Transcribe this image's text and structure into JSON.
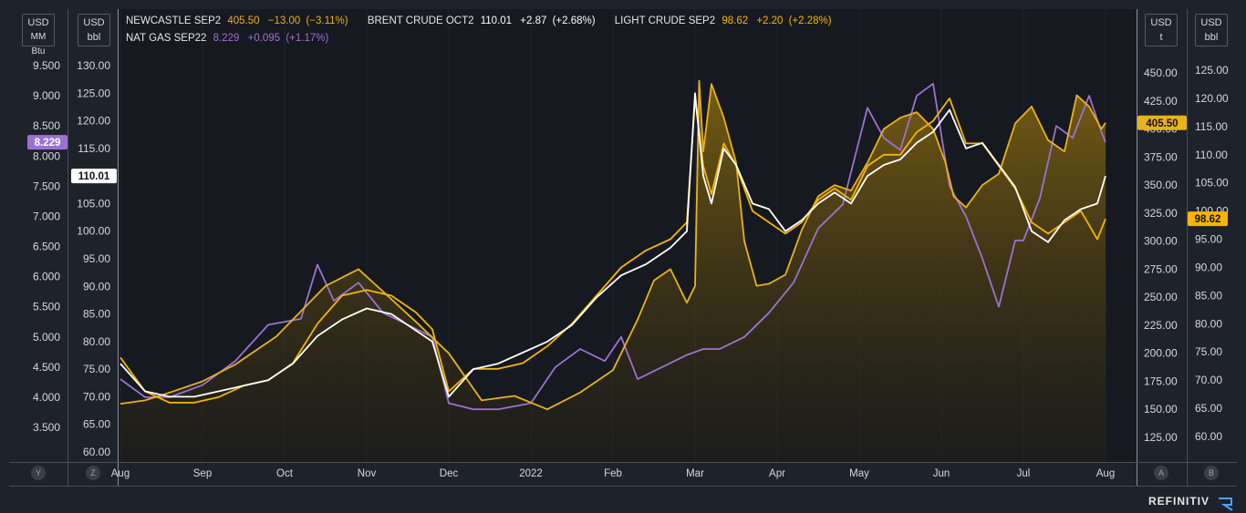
{
  "header": {
    "row1": [
      {
        "name": "NEWCASTLE SEP2",
        "value": "405.50",
        "change": "−13.00",
        "pct": "(−3.11%)",
        "color": "#e8b21e"
      },
      {
        "name": "BRENT CRUDE OCT2",
        "value": "110.01",
        "change": "+2.87",
        "pct": "(+2.68%)",
        "color": "#ffffff"
      },
      {
        "name": "LIGHT CRUDE SEP2",
        "value": "98.62",
        "change": "+2.20",
        "pct": "(+2.28%)",
        "color": "#f7b500"
      }
    ],
    "row2": [
      {
        "name": "NAT GAS SEP22",
        "value": "8.229",
        "change": "+0.095",
        "pct": "(+1.17%)",
        "color": "#9b72d0"
      }
    ]
  },
  "units": {
    "left1": {
      "cur": "USD",
      "unit": "MM Btu"
    },
    "left2": {
      "cur": "USD",
      "unit": "bbl"
    },
    "right1": {
      "cur": "USD",
      "unit": "t"
    },
    "right2": {
      "cur": "USD",
      "unit": "bbl"
    }
  },
  "axis_buttons": {
    "y": "Y",
    "z": "Z",
    "a": "A",
    "b": "B"
  },
  "brand": "REFINITIV",
  "colors": {
    "background": "#1e222b",
    "plot": "#161920",
    "coal": "#e8b21e",
    "brent": "#ffffff",
    "wti": "#f7b500",
    "gas": "#9b72d0"
  },
  "chart_data": {
    "type": "line",
    "x_labels": [
      "Aug",
      "Sep",
      "Oct",
      "Nov",
      "Dec",
      "2022",
      "Feb",
      "Mar",
      "Apr",
      "May",
      "Jun",
      "Jul",
      "Aug"
    ],
    "axes": {
      "gas": {
        "ticks": [
          "9.500",
          "9.000",
          "8.500",
          "8.000",
          "7.500",
          "7.000",
          "6.500",
          "6.000",
          "5.500",
          "5.000",
          "4.500",
          "4.000",
          "3.500"
        ],
        "range": [
          3.5,
          9.5
        ]
      },
      "oil_left": {
        "ticks": [
          "130.00",
          "125.00",
          "120.00",
          "115.00",
          "110.00",
          "105.00",
          "100.00",
          "95.00",
          "90.00",
          "85.00",
          "80.00",
          "75.00",
          "70.00",
          "65.00",
          "60.00"
        ],
        "range": [
          60,
          130
        ]
      },
      "coal": {
        "ticks": [
          "450.00",
          "425.00",
          "400.00",
          "375.00",
          "350.00",
          "325.00",
          "300.00",
          "275.00",
          "250.00",
          "225.00",
          "200.00",
          "175.00",
          "150.00",
          "125.00"
        ],
        "range": [
          125,
          450
        ]
      },
      "oil_right": {
        "ticks": [
          "125.00",
          "120.00",
          "115.00",
          "110.00",
          "105.00",
          "100.00",
          "95.00",
          "90.00",
          "85.00",
          "80.00",
          "75.00",
          "70.00",
          "65.00",
          "60.00"
        ],
        "range": [
          60,
          125
        ]
      }
    },
    "last_value_labels": {
      "gas": "8.229",
      "brent": "110.01",
      "coal": "405.50",
      "wti": "98.62"
    },
    "series": [
      {
        "name": "NEWCASTLE SEP2",
        "axis": "coal",
        "area": true,
        "x": [
          0,
          0.3,
          0.6,
          1,
          1.4,
          1.9,
          2.5,
          2.9,
          3.2,
          3.6,
          4,
          4.4,
          4.8,
          5.2,
          5.6,
          6,
          6.3,
          6.5,
          6.7,
          6.9,
          7,
          7.05,
          7.1,
          7.2,
          7.35,
          7.5,
          7.6,
          7.75,
          7.9,
          8.1,
          8.3,
          8.5,
          8.7,
          8.9,
          9.1,
          9.3,
          9.5,
          9.7,
          9.9,
          10.05,
          10.15,
          10.3,
          10.5,
          10.7,
          10.9,
          11.1,
          11.3,
          11.5,
          11.65,
          11.8,
          11.95,
          12
        ],
        "y": [
          155,
          158,
          165,
          175,
          190,
          215,
          260,
          275,
          255,
          228,
          200,
          158,
          162,
          150,
          165,
          185,
          230,
          265,
          275,
          245,
          260,
          443,
          380,
          440,
          410,
          370,
          300,
          260,
          262,
          270,
          310,
          340,
          350,
          345,
          370,
          400,
          410,
          415,
          400,
          370,
          340,
          330,
          350,
          360,
          405,
          420,
          390,
          380,
          430,
          420,
          400,
          405.5
        ]
      },
      {
        "name": "BRENT CRUDE OCT2",
        "axis": "oil_left",
        "x": [
          0,
          0.3,
          0.6,
          0.9,
          1.2,
          1.5,
          1.8,
          2.1,
          2.4,
          2.7,
          3,
          3.3,
          3.6,
          3.8,
          4,
          4.3,
          4.6,
          4.9,
          5.2,
          5.5,
          5.8,
          6.1,
          6.4,
          6.7,
          6.9,
          7,
          7.1,
          7.2,
          7.35,
          7.5,
          7.7,
          7.9,
          8.1,
          8.3,
          8.5,
          8.7,
          8.9,
          9.1,
          9.3,
          9.5,
          9.7,
          9.9,
          10.1,
          10.3,
          10.5,
          10.7,
          10.9,
          11.1,
          11.3,
          11.5,
          11.7,
          11.9,
          12
        ],
        "y": [
          76,
          71,
          70,
          70,
          71,
          72,
          73,
          76,
          81,
          84,
          86,
          85,
          82,
          80,
          70,
          75,
          76,
          78,
          80,
          83,
          88,
          92,
          94,
          97,
          100,
          125,
          110,
          105,
          115,
          112,
          105,
          104,
          100,
          102,
          105,
          107,
          105,
          110,
          112,
          113,
          116,
          118,
          122,
          115,
          116,
          112,
          108,
          100,
          98,
          102,
          104,
          105,
          110.01
        ]
      },
      {
        "name": "LIGHT CRUDE SEP2",
        "axis": "oil_right",
        "x": [
          0,
          0.3,
          0.6,
          0.9,
          1.2,
          1.5,
          1.8,
          2.1,
          2.4,
          2.7,
          3,
          3.3,
          3.6,
          3.8,
          4,
          4.3,
          4.6,
          4.9,
          5.2,
          5.5,
          5.8,
          6.1,
          6.4,
          6.7,
          6.9,
          7,
          7.1,
          7.2,
          7.35,
          7.5,
          7.7,
          7.9,
          8.1,
          8.3,
          8.5,
          8.7,
          8.9,
          9.1,
          9.3,
          9.5,
          9.7,
          9.9,
          10.1,
          10.3,
          10.5,
          10.7,
          10.9,
          11.1,
          11.3,
          11.5,
          11.7,
          11.9,
          12
        ],
        "y": [
          74,
          68,
          66,
          66,
          67,
          69,
          70,
          73,
          80,
          85,
          86,
          85,
          82,
          79,
          68,
          72,
          72,
          73,
          76,
          80,
          85,
          90,
          93,
          95,
          98,
          120,
          108,
          103,
          112,
          108,
          100,
          98,
          96,
          98,
          102,
          104,
          102,
          108,
          110,
          110,
          114,
          116,
          120,
          112,
          112,
          108,
          104,
          98,
          96,
          98,
          100,
          95,
          98.62
        ]
      },
      {
        "name": "NAT GAS SEP22",
        "axis": "gas",
        "x": [
          0,
          0.3,
          0.6,
          1,
          1.4,
          1.8,
          2.2,
          2.4,
          2.6,
          2.9,
          3.2,
          3.5,
          3.8,
          4,
          4.3,
          4.6,
          5,
          5.3,
          5.6,
          5.9,
          6.1,
          6.3,
          6.6,
          6.9,
          7.1,
          7.3,
          7.6,
          7.9,
          8.2,
          8.5,
          8.8,
          9.1,
          9.3,
          9.5,
          9.7,
          9.9,
          10.1,
          10.3,
          10.5,
          10.7,
          10.9,
          11,
          11.2,
          11.4,
          11.6,
          11.8,
          11.95,
          12
        ],
        "y": [
          4.3,
          4.0,
          4.0,
          4.2,
          4.6,
          5.2,
          5.3,
          6.2,
          5.6,
          5.9,
          5.4,
          5.2,
          5.0,
          3.9,
          3.8,
          3.8,
          3.9,
          4.5,
          4.8,
          4.6,
          5.0,
          4.3,
          4.5,
          4.7,
          4.8,
          4.8,
          5.0,
          5.4,
          5.9,
          6.8,
          7.2,
          8.8,
          8.3,
          8.1,
          9.0,
          9.2,
          7.5,
          7.0,
          6.3,
          5.5,
          6.6,
          6.6,
          7.3,
          8.5,
          8.3,
          9.0,
          8.4,
          8.229
        ]
      }
    ]
  }
}
